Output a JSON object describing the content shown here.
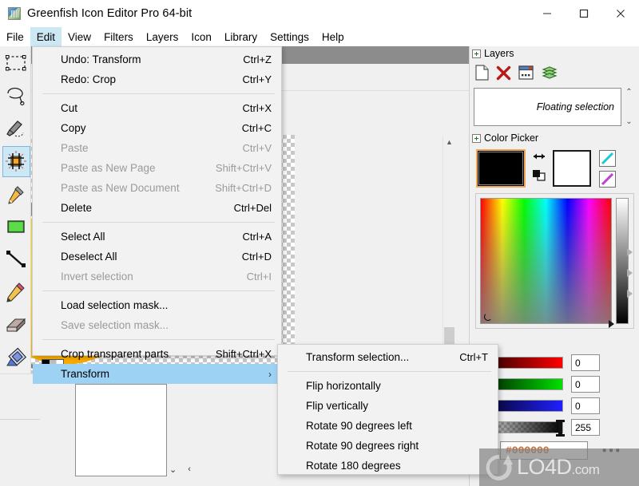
{
  "window": {
    "title": "Greenfish Icon Editor Pro 64-bit",
    "app_icon": "app-icon",
    "minimize": "–",
    "maximize": "☐",
    "close": "✕"
  },
  "menubar": {
    "items": [
      {
        "label": "File",
        "active": false
      },
      {
        "label": "Edit",
        "active": true
      },
      {
        "label": "View",
        "active": false
      },
      {
        "label": "Filters",
        "active": false
      },
      {
        "label": "Layers",
        "active": false
      },
      {
        "label": "Icon",
        "active": false
      },
      {
        "label": "Library",
        "active": false
      },
      {
        "label": "Settings",
        "active": false
      },
      {
        "label": "Help",
        "active": false
      }
    ]
  },
  "edit_menu": {
    "groups": [
      [
        {
          "label": "Undo: Transform",
          "accel": "Ctrl+Z",
          "disabled": false
        },
        {
          "label": "Redo: Crop",
          "accel": "Ctrl+Y",
          "disabled": false
        }
      ],
      [
        {
          "label": "Cut",
          "accel": "Ctrl+X",
          "disabled": false
        },
        {
          "label": "Copy",
          "accel": "Ctrl+C",
          "disabled": false
        },
        {
          "label": "Paste",
          "accel": "Ctrl+V",
          "disabled": true
        },
        {
          "label": "Paste as New Page",
          "accel": "Shift+Ctrl+V",
          "disabled": true
        },
        {
          "label": "Paste as New Document",
          "accel": "Shift+Ctrl+D",
          "disabled": true
        },
        {
          "label": "Delete",
          "accel": "Ctrl+Del",
          "disabled": false
        }
      ],
      [
        {
          "label": "Select All",
          "accel": "Ctrl+A",
          "disabled": false
        },
        {
          "label": "Deselect All",
          "accel": "Ctrl+D",
          "disabled": false
        },
        {
          "label": "Invert selection",
          "accel": "Ctrl+I",
          "disabled": true
        }
      ],
      [
        {
          "label": "Load selection mask...",
          "accel": "",
          "disabled": false
        },
        {
          "label": "Save selection mask...",
          "accel": "",
          "disabled": true
        }
      ],
      [
        {
          "label": "Crop transparent parts",
          "accel": "Shift+Ctrl+X",
          "disabled": false
        },
        {
          "label": "Transform",
          "accel": "",
          "disabled": false,
          "submenu": true,
          "highlighted": true
        }
      ]
    ],
    "submenu_arrow": "›"
  },
  "transform_menu": {
    "groups": [
      [
        {
          "label": "Transform selection...",
          "accel": "Ctrl+T"
        }
      ],
      [
        {
          "label": "Flip horizontally",
          "accel": ""
        },
        {
          "label": "Flip vertically",
          "accel": ""
        },
        {
          "label": "Rotate 90 degrees left",
          "accel": ""
        },
        {
          "label": "Rotate 90 degrees right",
          "accel": ""
        },
        {
          "label": "Rotate 180 degrees",
          "accel": ""
        }
      ]
    ]
  },
  "tools": [
    {
      "name": "rectangle-select-tool",
      "selected": false
    },
    {
      "name": "lasso-select-tool",
      "selected": false
    },
    {
      "name": "freehand-select-tool",
      "selected": false
    },
    {
      "name": "crop-tool",
      "selected": true
    },
    {
      "name": "color-picker-tool",
      "selected": false
    },
    {
      "name": "paint-bucket-tool",
      "selected": false
    },
    {
      "name": "line-tool",
      "selected": false
    },
    {
      "name": "pencil-tool",
      "selected": false
    },
    {
      "name": "eraser-tool",
      "selected": false
    },
    {
      "name": "shape-tool",
      "selected": false
    }
  ],
  "canvas_toolbar": {
    "buttons": [
      {
        "name": "fit-width-icon",
        "active": false
      },
      {
        "name": "grid-icon",
        "active": true
      },
      {
        "name": "guides-icon",
        "active": true
      },
      {
        "name": "pages-icon",
        "active": true
      },
      {
        "name": "zoom-icon",
        "active": false
      }
    ]
  },
  "layers_panel": {
    "title": "Layers",
    "buttons": [
      {
        "name": "new-layer-icon"
      },
      {
        "name": "delete-layer-icon"
      },
      {
        "name": "layer-properties-icon"
      },
      {
        "name": "merge-layers-icon"
      }
    ],
    "entries": [
      {
        "label": "Floating selection"
      }
    ],
    "scroll_up": "⌃",
    "scroll_down": "⌄"
  },
  "color_picker": {
    "title": "Color Picker",
    "foreground": "#000000",
    "background": "#ffffff",
    "swap_icon": "swap-colors-icon",
    "reset_icon": "reset-colors-icon",
    "gradient_buttons": [
      {
        "name": "gradient-cyan-button",
        "from": "#00b7c2",
        "to": "#00e5d0"
      },
      {
        "name": "gradient-magenta-button",
        "from": "#9b1fa8",
        "to": "#e040fb"
      }
    ],
    "channels": [
      {
        "name": "red",
        "value": "0",
        "from": "#000000",
        "to": "#ff0000",
        "knob_pct": 0
      },
      {
        "name": "green",
        "value": "0",
        "from": "#000000",
        "to": "#00e000",
        "knob_pct": 0
      },
      {
        "name": "blue",
        "value": "0",
        "from": "#000000",
        "to": "#2020ff",
        "knob_pct": 0
      },
      {
        "name": "alpha",
        "value": "255",
        "from": "transparent",
        "to": "#000000",
        "knob_pct": 100
      }
    ],
    "hex": "#000000",
    "more_dots": "▪▪▪"
  },
  "preview": {
    "nav_down": "⌄",
    "nav_left": "‹"
  },
  "watermark": {
    "text": "LO4D",
    "suffix": ".com"
  }
}
